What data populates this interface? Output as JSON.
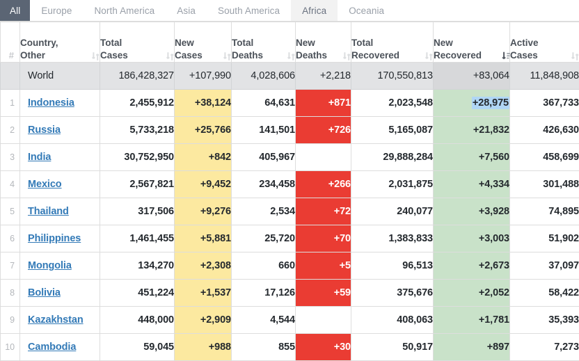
{
  "tabs": [
    {
      "label": "All",
      "state": "active"
    },
    {
      "label": "Europe",
      "state": "normal"
    },
    {
      "label": "North America",
      "state": "normal"
    },
    {
      "label": "Asia",
      "state": "normal"
    },
    {
      "label": "South America",
      "state": "normal"
    },
    {
      "label": "Africa",
      "state": "hover"
    },
    {
      "label": "Oceania",
      "state": "normal"
    }
  ],
  "table": {
    "columns": [
      {
        "key": "idx",
        "line1": "",
        "line2": "#",
        "sort": "none"
      },
      {
        "key": "country",
        "line1": "Country,",
        "line2": "Other",
        "sort": "neutral"
      },
      {
        "key": "total_cases",
        "line1": "Total",
        "line2": "Cases",
        "sort": "neutral"
      },
      {
        "key": "new_cases",
        "line1": "New",
        "line2": "Cases",
        "sort": "neutral"
      },
      {
        "key": "total_deaths",
        "line1": "Total",
        "line2": "Deaths",
        "sort": "neutral"
      },
      {
        "key": "new_deaths",
        "line1": "New",
        "line2": "Deaths",
        "sort": "neutral"
      },
      {
        "key": "total_recov",
        "line1": "Total",
        "line2": "Recovered",
        "sort": "neutral"
      },
      {
        "key": "new_recov",
        "line1": "New",
        "line2": "Recovered",
        "sort": "desc"
      },
      {
        "key": "active_cases",
        "line1": "Active",
        "line2": "Cases",
        "sort": "neutral"
      }
    ],
    "world_row": {
      "idx": "",
      "country": "World",
      "total_cases": "186,428,327",
      "new_cases": "+107,990",
      "total_deaths": "4,028,606",
      "new_deaths": "+2,218",
      "total_recov": "170,550,813",
      "new_recov": "+83,064",
      "active_cases": "11,848,908"
    },
    "rows": [
      {
        "idx": "1",
        "country": "Indonesia",
        "total_cases": "2,455,912",
        "new_cases": "+38,124",
        "total_deaths": "64,631",
        "new_deaths": "+871",
        "total_recov": "2,023,548",
        "new_recov": "+28,975",
        "active_cases": "367,733",
        "new_recov_selected": true
      },
      {
        "idx": "2",
        "country": "Russia",
        "total_cases": "5,733,218",
        "new_cases": "+25,766",
        "total_deaths": "141,501",
        "new_deaths": "+726",
        "total_recov": "5,165,087",
        "new_recov": "+21,832",
        "active_cases": "426,630",
        "new_recov_selected": false
      },
      {
        "idx": "3",
        "country": "India",
        "total_cases": "30,752,950",
        "new_cases": "+842",
        "total_deaths": "405,967",
        "new_deaths": "",
        "total_recov": "29,888,284",
        "new_recov": "+7,560",
        "active_cases": "458,699",
        "new_recov_selected": false
      },
      {
        "idx": "4",
        "country": "Mexico",
        "total_cases": "2,567,821",
        "new_cases": "+9,452",
        "total_deaths": "234,458",
        "new_deaths": "+266",
        "total_recov": "2,031,875",
        "new_recov": "+4,334",
        "active_cases": "301,488",
        "new_recov_selected": false
      },
      {
        "idx": "5",
        "country": "Thailand",
        "total_cases": "317,506",
        "new_cases": "+9,276",
        "total_deaths": "2,534",
        "new_deaths": "+72",
        "total_recov": "240,077",
        "new_recov": "+3,928",
        "active_cases": "74,895",
        "new_recov_selected": false
      },
      {
        "idx": "6",
        "country": "Philippines",
        "total_cases": "1,461,455",
        "new_cases": "+5,881",
        "total_deaths": "25,720",
        "new_deaths": "+70",
        "total_recov": "1,383,833",
        "new_recov": "+3,003",
        "active_cases": "51,902",
        "new_recov_selected": false
      },
      {
        "idx": "7",
        "country": "Mongolia",
        "total_cases": "134,270",
        "new_cases": "+2,308",
        "total_deaths": "660",
        "new_deaths": "+5",
        "total_recov": "96,513",
        "new_recov": "+2,673",
        "active_cases": "37,097",
        "new_recov_selected": false
      },
      {
        "idx": "8",
        "country": "Bolivia",
        "total_cases": "451,224",
        "new_cases": "+1,537",
        "total_deaths": "17,126",
        "new_deaths": "+59",
        "total_recov": "375,676",
        "new_recov": "+2,052",
        "active_cases": "58,422",
        "new_recov_selected": false
      },
      {
        "idx": "9",
        "country": "Kazakhstan",
        "total_cases": "448,000",
        "new_cases": "+2,909",
        "total_deaths": "4,544",
        "new_deaths": "",
        "total_recov": "408,063",
        "new_recov": "+1,781",
        "active_cases": "35,393",
        "new_recov_selected": false
      },
      {
        "idx": "10",
        "country": "Cambodia",
        "total_cases": "59,045",
        "new_cases": "+988",
        "total_deaths": "855",
        "new_deaths": "+30",
        "total_recov": "50,917",
        "new_recov": "+897",
        "active_cases": "7,273",
        "new_recov_selected": false
      }
    ]
  },
  "colors": {
    "tab_active_bg": "#5b6574",
    "tab_hover_bg": "#f2f2f2",
    "tint_yellow": "#fce9a0",
    "tint_red": "#ea3c33",
    "tint_green": "#c9e2c9",
    "world_row_bg": "#e2e3e5",
    "sorted_col_bg": "#d7d8da",
    "link_blue": "#337ab7",
    "selection_blue": "#b0d6f5"
  }
}
